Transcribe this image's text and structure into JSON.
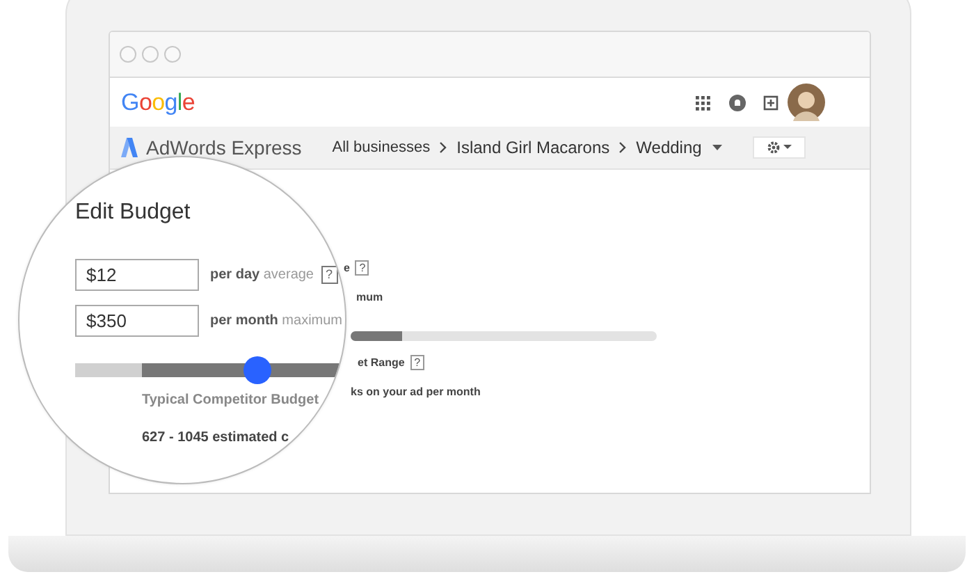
{
  "header": {
    "logo": "Google"
  },
  "navbar": {
    "product": "AdWords Express",
    "breadcrumbs": [
      {
        "label": "All businesses",
        "dropdown": false
      },
      {
        "label": "Island Girl Macarons",
        "dropdown": false
      },
      {
        "label": "Wedding",
        "dropdown": true
      }
    ]
  },
  "background_form": [
    {
      "kind": "text",
      "text": "e",
      "help": "?"
    },
    {
      "kind": "text",
      "text": "mum"
    },
    {
      "kind": "bar",
      "level": 0.17
    },
    {
      "kind": "text",
      "text": "et Range",
      "help": "?"
    },
    {
      "kind": "text",
      "text": "ks on your ad per month"
    }
  ],
  "magnifier": {
    "title": "Edit Budget",
    "fields": [
      {
        "value": "$12",
        "label": "per day",
        "suffix": "average",
        "help": "?"
      },
      {
        "value": "$350",
        "label": "per month",
        "suffix": "maximum"
      }
    ],
    "slider": {
      "level": 0.67
    },
    "range_label": "Typical Competitor Budget",
    "estimate": "627 - 1045 estimated c"
  }
}
